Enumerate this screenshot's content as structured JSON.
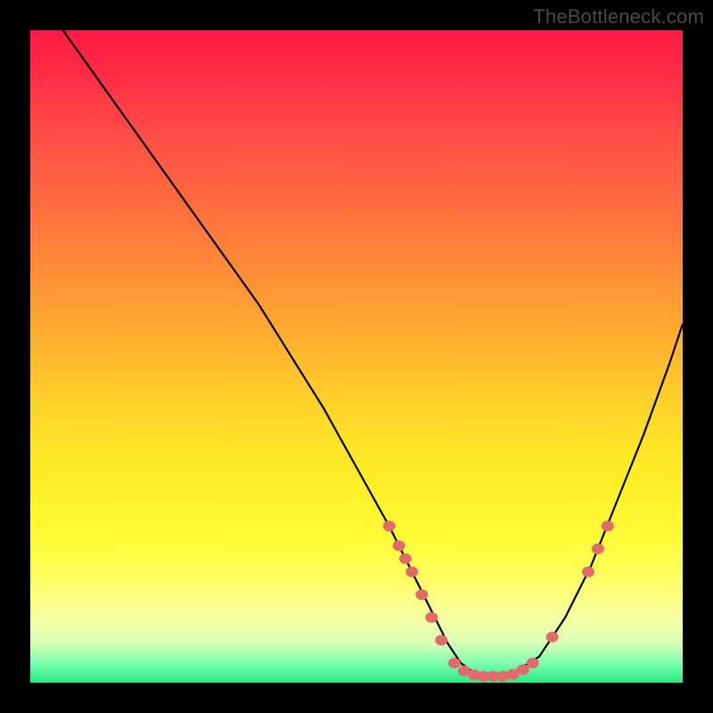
{
  "watermark": "TheBottleneck.com",
  "chart_data": {
    "type": "line",
    "title": "",
    "xlabel": "",
    "ylabel": "",
    "xlim": [
      0,
      100
    ],
    "ylim": [
      0,
      100
    ],
    "series": [
      {
        "name": "curve",
        "x": [
          5,
          10,
          15,
          20,
          25,
          30,
          35,
          40,
          45,
          50,
          55,
          58,
          60,
          62,
          64,
          66,
          68,
          70,
          72,
          74,
          78,
          82,
          86,
          90,
          94,
          98,
          100
        ],
        "values": [
          100,
          93,
          86,
          79,
          72,
          65,
          58,
          50,
          42,
          33,
          24,
          18,
          14,
          10,
          6,
          3,
          1.5,
          1,
          1,
          1.5,
          4,
          10,
          18,
          28,
          38,
          49,
          55
        ]
      }
    ],
    "markers": [
      {
        "x": 55.0,
        "y": 24.0
      },
      {
        "x": 56.5,
        "y": 21.0
      },
      {
        "x": 57.5,
        "y": 19.0
      },
      {
        "x": 58.5,
        "y": 17.0
      },
      {
        "x": 60.0,
        "y": 13.5
      },
      {
        "x": 61.5,
        "y": 10.0
      },
      {
        "x": 63.0,
        "y": 6.5
      },
      {
        "x": 65.0,
        "y": 3.0
      },
      {
        "x": 66.5,
        "y": 1.8
      },
      {
        "x": 68.0,
        "y": 1.2
      },
      {
        "x": 69.5,
        "y": 1.0
      },
      {
        "x": 71.0,
        "y": 1.0
      },
      {
        "x": 72.5,
        "y": 1.0
      },
      {
        "x": 74.0,
        "y": 1.3
      },
      {
        "x": 75.5,
        "y": 2.0
      },
      {
        "x": 77.0,
        "y": 3.0
      },
      {
        "x": 80.0,
        "y": 7.0
      },
      {
        "x": 85.5,
        "y": 17.0
      },
      {
        "x": 87.0,
        "y": 20.5
      },
      {
        "x": 88.5,
        "y": 24.0
      }
    ],
    "colors": {
      "curve": "#000000",
      "marker": "#e26a6a"
    }
  }
}
